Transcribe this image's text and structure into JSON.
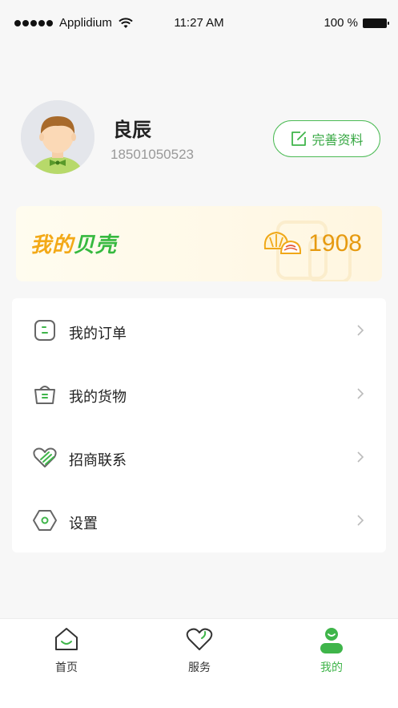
{
  "status_bar": {
    "carrier": "Applidium",
    "time": "11:27 AM",
    "battery": "100 %"
  },
  "profile": {
    "name": "良辰",
    "phone": "18501050523",
    "edit_label": "完善资料"
  },
  "shells": {
    "title_part1": "我的",
    "title_part2": "贝壳",
    "count": "1908"
  },
  "menu": {
    "items": [
      {
        "label": "我的订单",
        "icon": "order-icon"
      },
      {
        "label": "我的货物",
        "icon": "basket-icon"
      },
      {
        "label": "招商联系",
        "icon": "handshake-heart-icon"
      },
      {
        "label": "设置",
        "icon": "settings-hexagon-icon"
      }
    ]
  },
  "tabbar": {
    "tabs": [
      {
        "label": "首页",
        "icon": "home-icon",
        "active": false
      },
      {
        "label": "服务",
        "icon": "heart-icon",
        "active": false
      },
      {
        "label": "我的",
        "icon": "user-icon",
        "active": true
      }
    ]
  },
  "colors": {
    "accent_green": "#3fb54a",
    "accent_orange": "#e69a10",
    "background": "#f7f7f7"
  }
}
